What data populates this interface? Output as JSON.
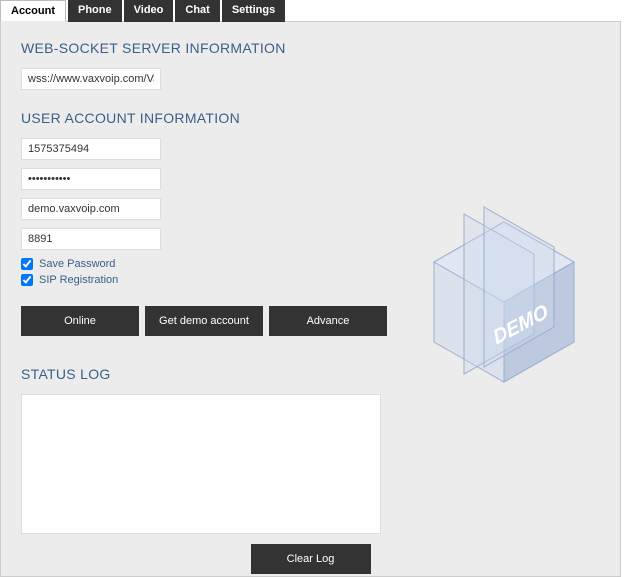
{
  "tabs": {
    "account": "Account",
    "phone": "Phone",
    "video": "Video",
    "chat": "Chat",
    "settings": "Settings"
  },
  "sections": {
    "websocket": "WEB-SOCKET SERVER INFORMATION",
    "user_account": "USER ACCOUNT INFORMATION",
    "status_log": "STATUS LOG"
  },
  "fields": {
    "ws_url": "wss://www.vaxvoip.com/VaxSocket",
    "username": "1575375494",
    "password": "•••••••••••",
    "domain": "demo.vaxvoip.com",
    "port": "8891"
  },
  "checks": {
    "save_password": "Save Password",
    "sip_registration": "SIP Registration"
  },
  "buttons": {
    "online": "Online",
    "get_demo": "Get demo account",
    "advance": "Advance",
    "clear_log": "Clear Log"
  },
  "demo_label": "DEMO"
}
